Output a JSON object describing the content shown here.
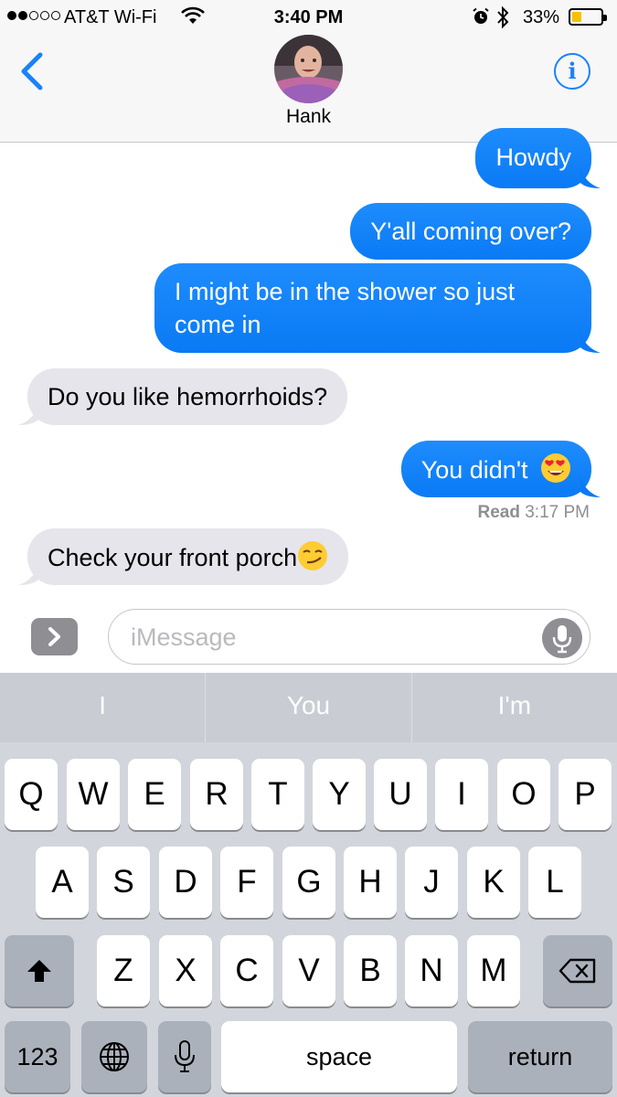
{
  "status_bar": {
    "carrier": "AT&T Wi-Fi",
    "time": "3:40 PM",
    "battery_percent": "33%",
    "battery_level": 0.33,
    "battery_color": "#f7c100",
    "icons": [
      "signal-dots",
      "wifi-icon",
      "alarm-icon",
      "bluetooth-icon",
      "battery-icon"
    ]
  },
  "header": {
    "contact_name": "Hank",
    "back_icon": "chevron-left-icon",
    "info_icon": "i",
    "avatar": "contact-photo"
  },
  "messages": [
    {
      "direction": "sent",
      "text": "Howdy"
    },
    {
      "direction": "sent",
      "text": "Y'all coming over?"
    },
    {
      "direction": "sent",
      "lines": [
        "I might be in the shower so just",
        "come in"
      ]
    },
    {
      "direction": "received",
      "text": "Do you like hemorrhoids?"
    },
    {
      "direction": "sent",
      "text": "You didn't",
      "emoji": "heart-eyes"
    }
  ],
  "read_receipt": {
    "label": "Read",
    "time": "3:17 PM"
  },
  "last_message": {
    "direction": "received",
    "text": "Check your front porch",
    "emoji": "smirk"
  },
  "composer": {
    "placeholder": "iMessage",
    "expand_icon": "chevron-right-icon",
    "mic_icon": "microphone-icon"
  },
  "keyboard": {
    "predictions": [
      "I",
      "You",
      "I'm"
    ],
    "row1": [
      "Q",
      "W",
      "E",
      "R",
      "T",
      "Y",
      "U",
      "I",
      "O",
      "P"
    ],
    "row2": [
      "A",
      "S",
      "D",
      "F",
      "G",
      "H",
      "J",
      "K",
      "L"
    ],
    "row3": [
      "Z",
      "X",
      "C",
      "V",
      "B",
      "N",
      "M"
    ],
    "numbers_label": "123",
    "space_label": "space",
    "return_label": "return",
    "shift_icon": "shift-arrow-icon",
    "delete_icon": "backspace-icon",
    "globe_icon": "globe-icon",
    "dictation_icon": "microphone-icon"
  },
  "colors": {
    "sent_bubble": "#1a82fb",
    "received_bubble": "#e6e5eb",
    "accent": "#1a82fb"
  }
}
